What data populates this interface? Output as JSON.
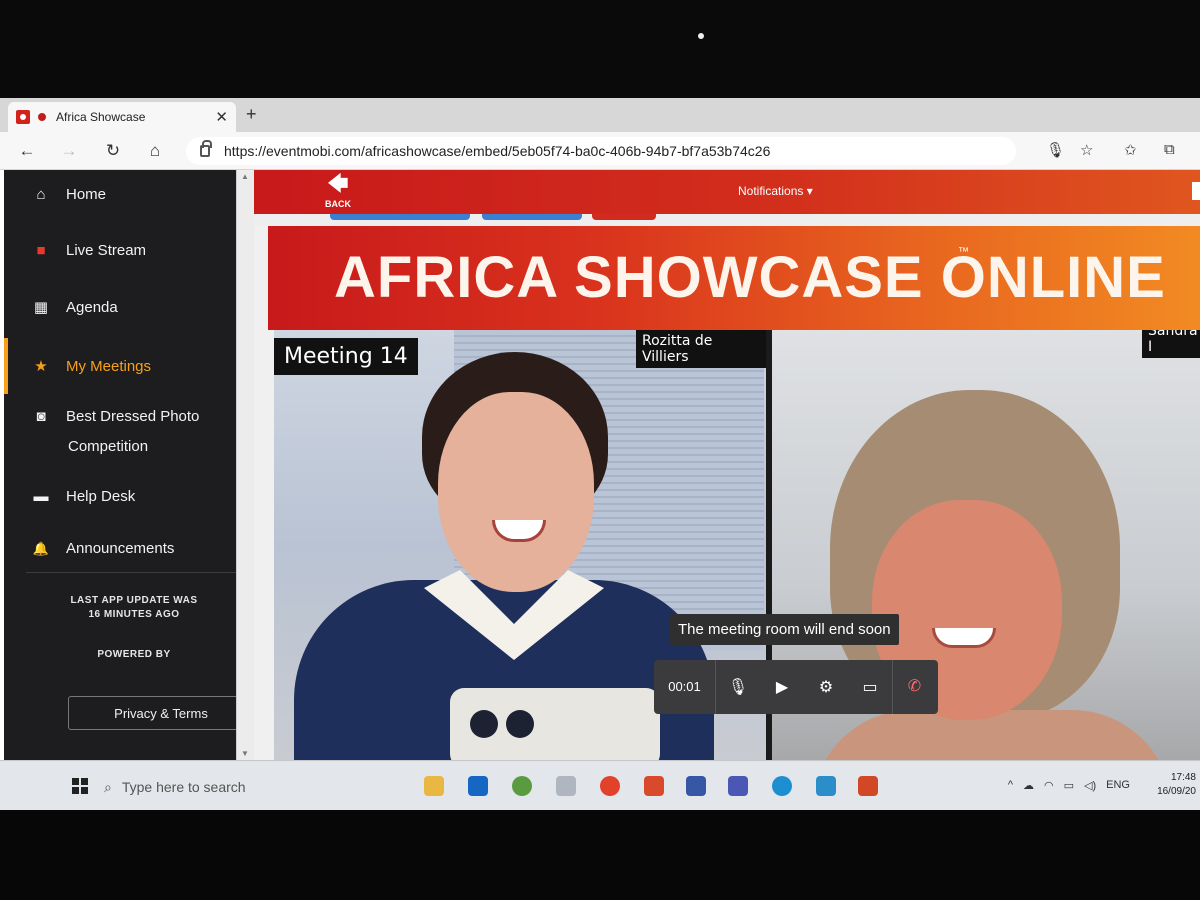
{
  "browser": {
    "tab_title": "Africa Showcase",
    "tab_close": "✕",
    "new_tab": "+",
    "url": "https://eventmobi.com/africashowcase/embed/5eb05f74-ba0c-406b-94b7-bf7a53b74c26",
    "nav": {
      "back": "←",
      "forward": "→",
      "reload": "↻",
      "home": "⌂"
    }
  },
  "sidebar": {
    "items": [
      {
        "label": "Home",
        "icon": "home-icon",
        "glyph": "⌂"
      },
      {
        "label": "Live Stream",
        "icon": "video-camera-icon",
        "glyph": "■"
      },
      {
        "label": "Agenda",
        "icon": "calendar-icon",
        "glyph": "▦"
      },
      {
        "label": "My Meetings",
        "icon": "star-icon",
        "glyph": "★",
        "active": true
      },
      {
        "label_line1": "Best Dressed Photo",
        "label_line2": "Competition",
        "icon": "photo-icon",
        "glyph": "◙"
      },
      {
        "label": "Help Desk",
        "icon": "folder-icon",
        "glyph": "▬"
      },
      {
        "label": "Announcements",
        "icon": "bell-icon",
        "glyph": "🔔"
      }
    ],
    "update_line1": "LAST APP UPDATE WAS",
    "update_line2": "16 MINUTES AGO",
    "powered_by": "POWERED BY",
    "privacy_button": "Privacy & Terms"
  },
  "header": {
    "back_label": "BACK",
    "back_glyph": "🡄",
    "notifications_label": "Notifications ▾"
  },
  "banner": {
    "text": "AFRICA SHOWCASE ONLINE",
    "tm": "™"
  },
  "meeting": {
    "title": "Meeting 14",
    "participant_left": "Rozitta de Villiers",
    "participant_right": "Sandra I",
    "toast": "The meeting room will end soon",
    "timer": "00:01",
    "controls": {
      "mic": "🎙",
      "camera": "▶",
      "settings": "⚙",
      "screen": "▭",
      "hangup": "✆"
    }
  },
  "taskbar": {
    "search_placeholder": "Type here to search",
    "language": "ENG",
    "time": "17:48",
    "date": "16/09/20"
  }
}
